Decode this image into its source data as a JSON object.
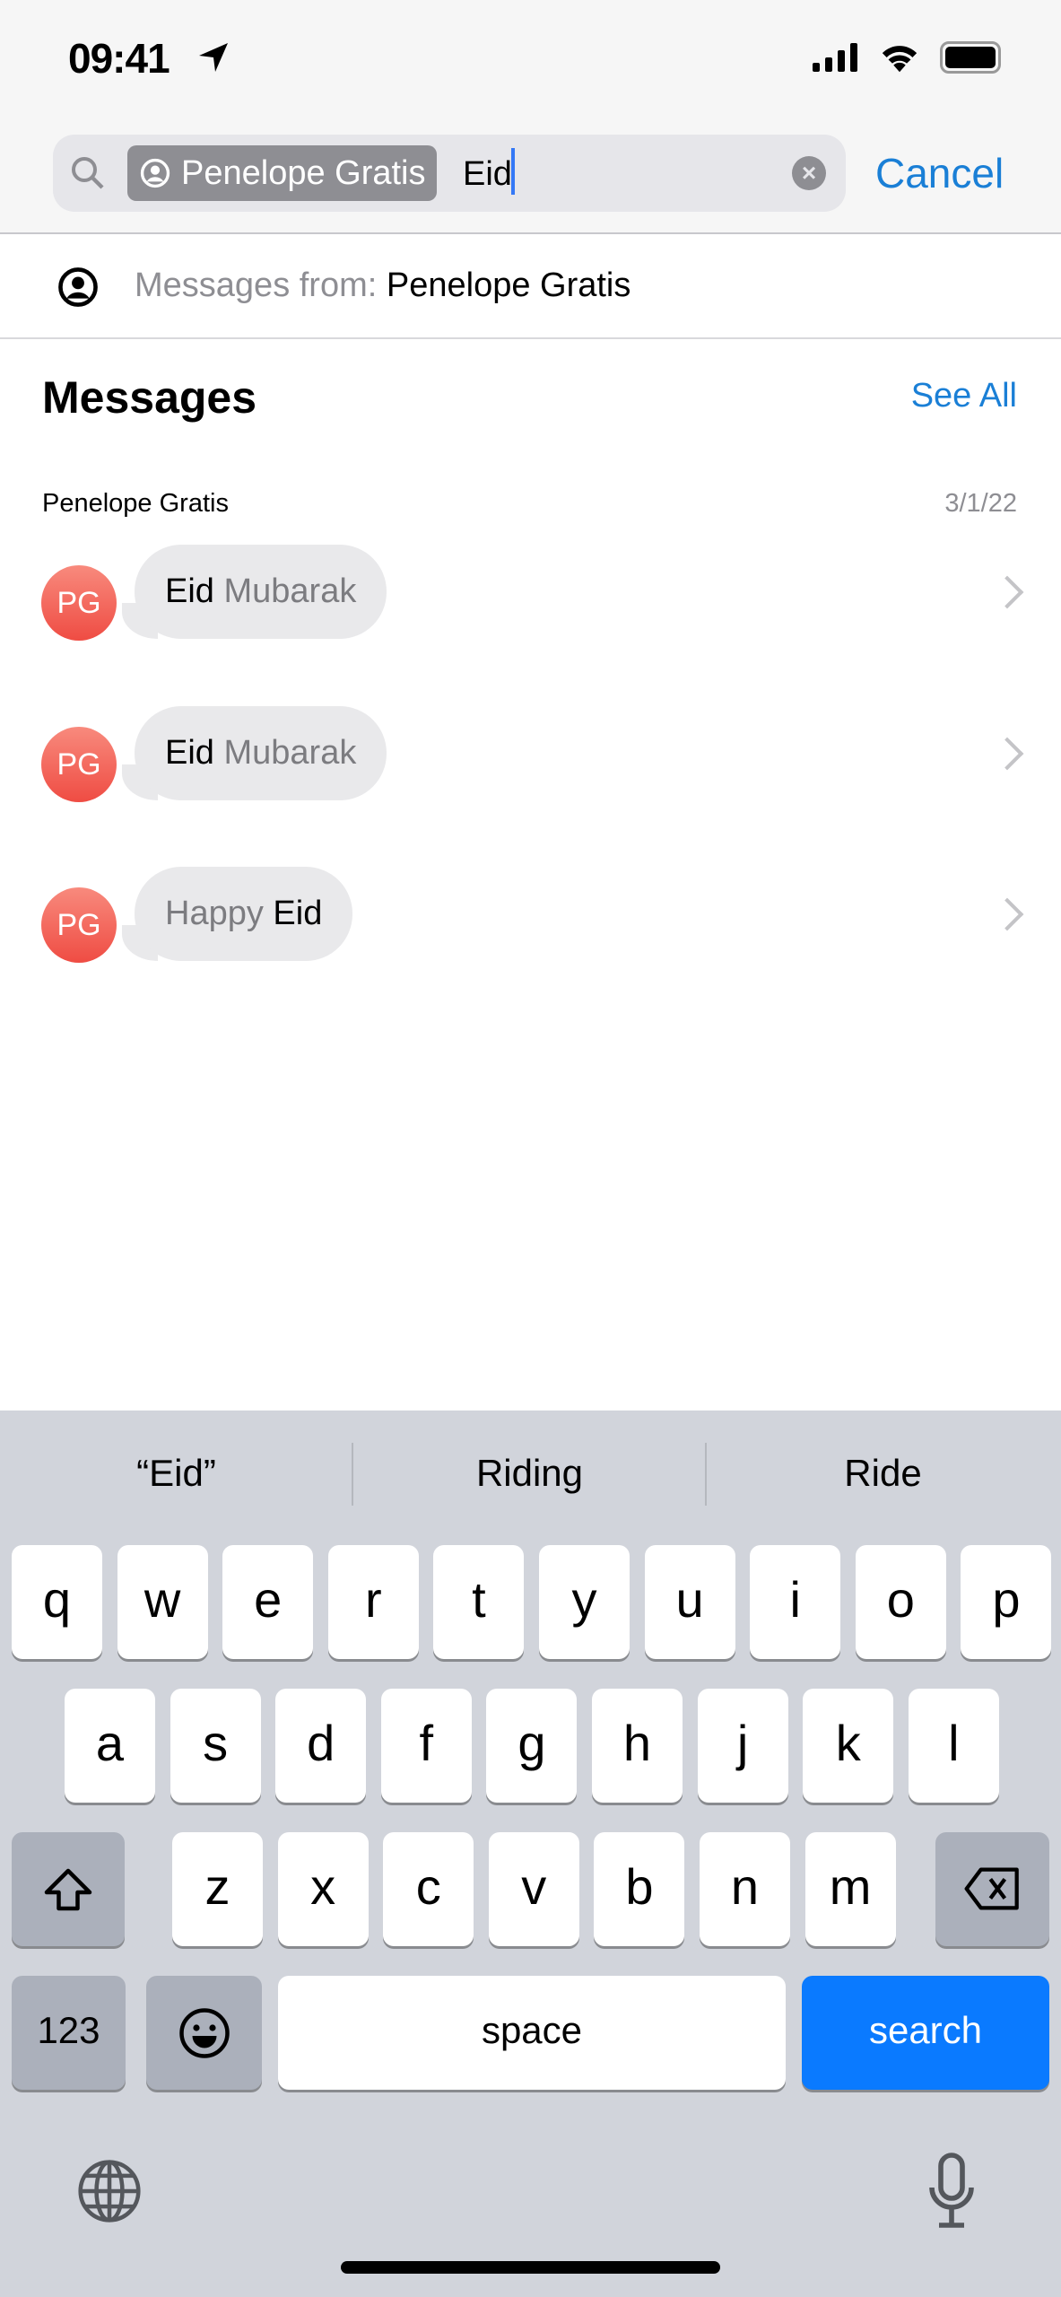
{
  "status": {
    "time": "09:41"
  },
  "search": {
    "token": "Penelope Gratis",
    "text": "Eid",
    "cancel": "Cancel"
  },
  "suggestion": {
    "prefix": "Messages from: ",
    "name": "Penelope Gratis"
  },
  "messages": {
    "title": "Messages",
    "see_all": "See All",
    "sender": "Penelope Gratis",
    "date": "3/1/22",
    "items": [
      {
        "avatar": "PG",
        "parts": [
          {
            "t": "Eid",
            "hl": true
          },
          {
            "t": " Mubarak",
            "hl": false
          }
        ]
      },
      {
        "avatar": "PG",
        "parts": [
          {
            "t": "Eid",
            "hl": true
          },
          {
            "t": " Mubarak",
            "hl": false
          }
        ]
      },
      {
        "avatar": "PG",
        "parts": [
          {
            "t": "Happy ",
            "hl": false
          },
          {
            "t": "Eid",
            "hl": true
          }
        ]
      }
    ]
  },
  "keyboard": {
    "suggestions": [
      "“Eid”",
      "Riding",
      "Ride"
    ],
    "rows": [
      [
        "q",
        "w",
        "e",
        "r",
        "t",
        "y",
        "u",
        "i",
        "o",
        "p"
      ],
      [
        "a",
        "s",
        "d",
        "f",
        "g",
        "h",
        "j",
        "k",
        "l"
      ],
      [
        "z",
        "x",
        "c",
        "v",
        "b",
        "n",
        "m"
      ]
    ],
    "numbers": "123",
    "space": "space",
    "search": "search",
    "search_color": "#0a7aff"
  }
}
